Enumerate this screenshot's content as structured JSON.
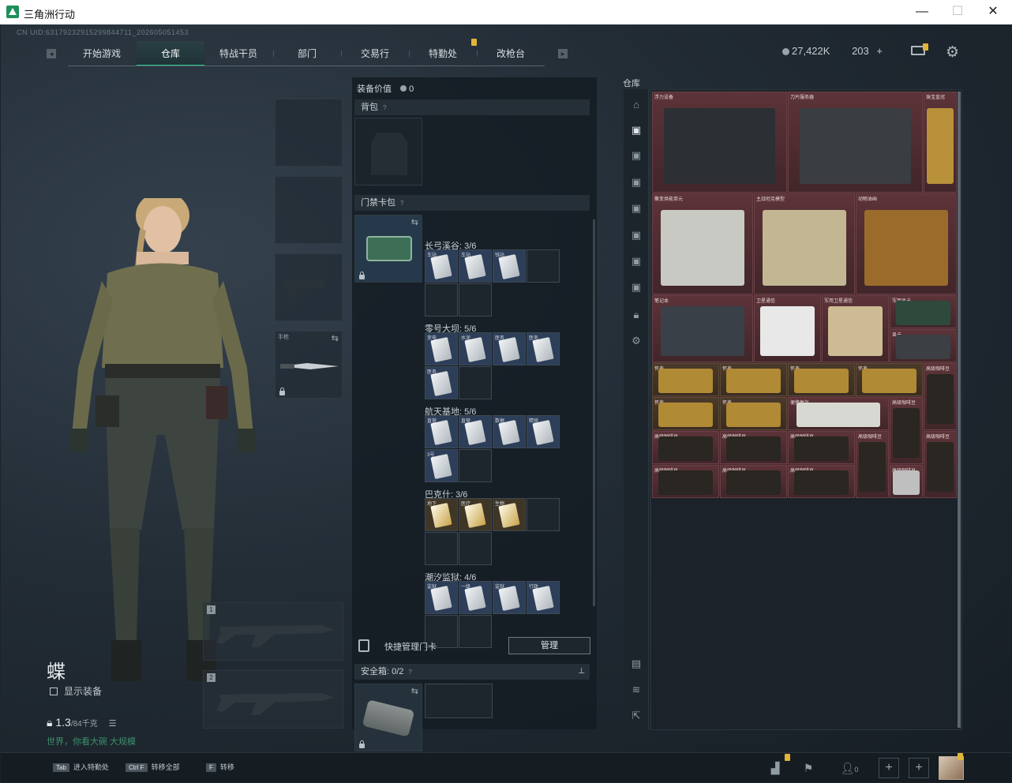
{
  "window": {
    "title": "三角洲行动"
  },
  "uid": "CN UID:631792329152998447​11_202605051453",
  "nav": {
    "tabs": [
      "开始游戏",
      "仓库",
      "特战干员",
      "部门",
      "交易行",
      "特勤处",
      "改枪台"
    ],
    "active": "仓库"
  },
  "currency": {
    "hafcoin": "27,422K",
    "tickets": "203"
  },
  "character": {
    "name": "蝶",
    "show_equipment": "显示装备",
    "weight": "1.3",
    "weight_max": "/84千克",
    "status": "世界，你看大碗 大规模"
  },
  "slots": {
    "knife_tag": "手枪",
    "weapon1": "1",
    "weapon2": "2"
  },
  "mid": {
    "equip_value_label": "装备价值",
    "equip_value": "0",
    "backpack_label": "背包",
    "keycard_label": "门禁卡包",
    "groups": [
      {
        "title": "长弓溪谷: 3/6",
        "cards": [
          "车站",
          "车站",
          "钱站"
        ]
      },
      {
        "title": "零号大坝: 5/6",
        "cards": [
          "变电",
          "水泥",
          "医务",
          "医务",
          "医务"
        ]
      },
      {
        "title": "航天基地: 5/6",
        "cards": [
          "直营",
          "直营",
          "数据",
          "精锐",
          "3号"
        ]
      },
      {
        "title": "巴克什: 3/6",
        "cards": [
          "地下",
          "医疗",
          "生物"
        ]
      },
      {
        "title": "潮汐监狱: 4/6",
        "cards": [
          "监狱",
          "一级",
          "监狱",
          "行政"
        ]
      }
    ],
    "quick_manage": "快捷管理门卡",
    "manage_button": "管理",
    "safebox_label": "安全箱:",
    "safebox_value": "0/2"
  },
  "storage": {
    "title": "仓库",
    "items": [
      {
        "label": "浮力设备"
      },
      {
        "label": "刀片服务器"
      },
      {
        "label": "珠宝皇冠"
      },
      {
        "label": "聚变供能单元"
      },
      {
        "label": "主战坦克模型"
      },
      {
        "label": "动物油画"
      },
      {
        "label": "笔记本"
      },
      {
        "label": "卫星通信"
      },
      {
        "label": "军用卫星通信"
      },
      {
        "label": "军用显卡"
      },
      {
        "label": "显卡"
      },
      {
        "label": "怀表"
      },
      {
        "label": "怀表"
      },
      {
        "label": "怀表"
      },
      {
        "label": "怀表"
      },
      {
        "label": "高级咖啡豆"
      },
      {
        "label": "怀表"
      },
      {
        "label": "怀表"
      },
      {
        "label": "便携氧气"
      },
      {
        "label": "高级咖啡豆"
      },
      {
        "label": "高级咖啡豆"
      },
      {
        "label": "高级咖啡豆"
      },
      {
        "label": "高级咖啡豆"
      },
      {
        "label": "高级咖啡豆"
      },
      {
        "label": "高级咖啡豆"
      },
      {
        "label": "高级咖啡豆"
      },
      {
        "label": "高级咖啡豆"
      },
      {
        "label": "高级咖啡豆"
      },
      {
        "label": "高级咖啡豆"
      },
      {
        "label": "高级咖啡豆"
      }
    ]
  },
  "bottom": {
    "hints": [
      {
        "key": "Tab",
        "label": "进入特勤处"
      },
      {
        "key": "Ctrl F",
        "label": "转移全部"
      },
      {
        "key": "F",
        "label": "转移"
      }
    ],
    "friends": "0",
    "avatar": "头像"
  },
  "colors": {
    "accent": "#27c08a",
    "storage_bg": "#4a2a2e",
    "badge": "#e0b53a"
  }
}
